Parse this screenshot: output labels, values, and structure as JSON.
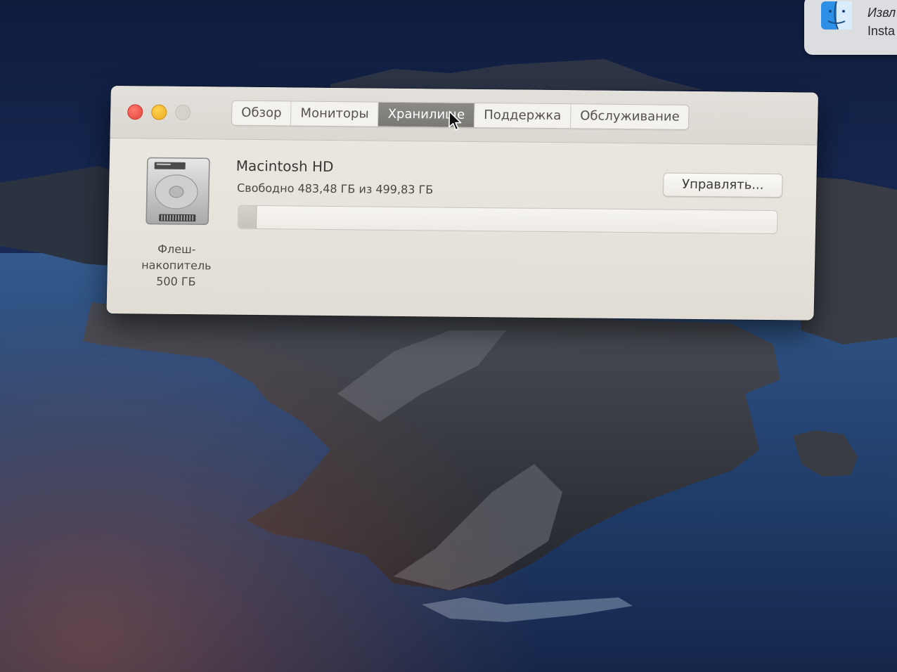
{
  "window": {
    "tabs": [
      {
        "label": "Обзор",
        "active": false
      },
      {
        "label": "Мониторы",
        "active": false
      },
      {
        "label": "Хранилище",
        "active": true
      },
      {
        "label": "Поддержка",
        "active": false
      },
      {
        "label": "Обслуживание",
        "active": false
      }
    ],
    "traffic_lights": {
      "close_color": "#e0443a",
      "minimize_color": "#e9a91f",
      "zoom_color": "#d5d2cc"
    }
  },
  "storage": {
    "volume_name": "Macintosh HD",
    "free_text": "Свободно 483,48 ГБ из 499,83 ГБ",
    "used_fraction": 0.033,
    "manage_button": "Управлять...",
    "disk_caption": [
      "Флеш-",
      "накопитель",
      "500 ГБ"
    ],
    "disk_icon": "hard-drive-icon"
  },
  "notification": {
    "icon": "finder-icon",
    "line1": "Извл",
    "line2": "Insta"
  },
  "colors": {
    "window_bg": "#e7e3dc",
    "active_tab": "#7b7975",
    "desktop_sea": "#24385e"
  }
}
